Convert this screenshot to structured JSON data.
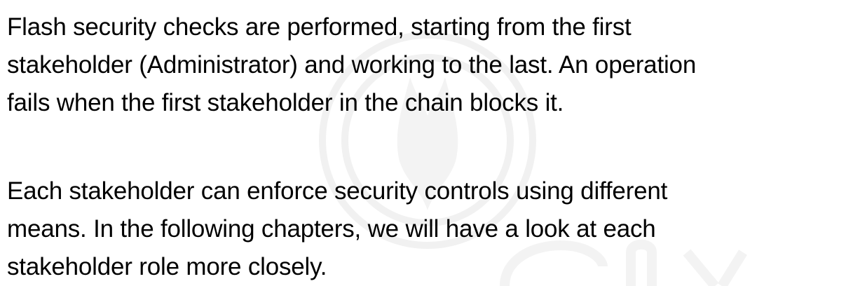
{
  "paragraphs": [
    {
      "lines": [
        "Flash security checks are performed, starting from the first",
        "stakeholder (Administrator) and working to the last. An operation",
        "fails when the first stakeholder in the chain blocks it."
      ]
    },
    {
      "lines": [
        "Each stakeholder can enforce security controls using different",
        "means. In the following chapters, we will have a look at each",
        "stakeholder role more closely."
      ]
    }
  ],
  "watermark": {
    "icon": "security-logo-watermark-icon",
    "color": "#ececec"
  }
}
